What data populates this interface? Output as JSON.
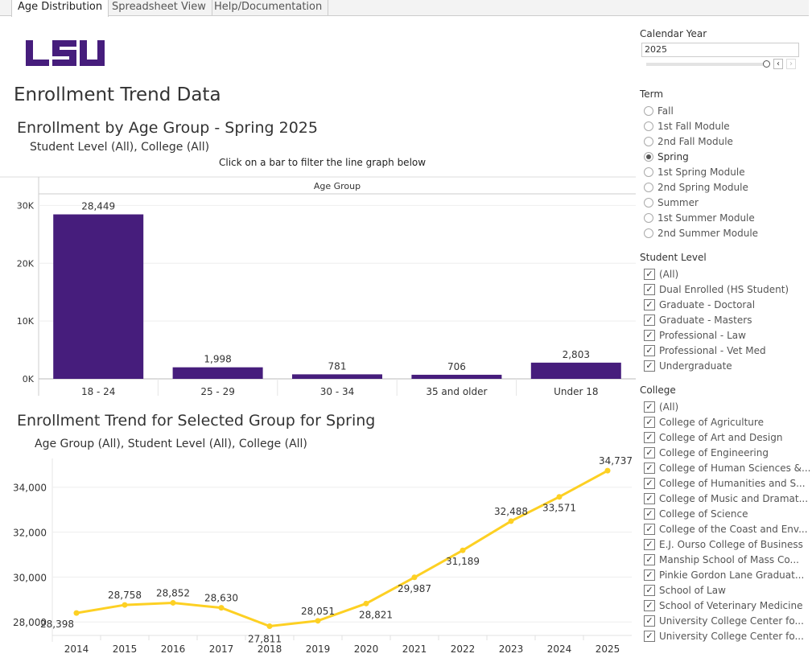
{
  "tabs": [
    "Age Distribution",
    "Spreadsheet View",
    "Help/Documentation"
  ],
  "logo_text": "LSU",
  "brand_color": "#461D7C",
  "line_color": "#FDD023",
  "page_title": "Enrollment Trend Data",
  "bar_section": {
    "title": "Enrollment by Age Group - Spring 2025",
    "subtitle": "Student Level (All), College (All)",
    "note": "Click on a bar to filter the line graph below"
  },
  "line_section": {
    "title": "Enrollment Trend for Selected Group for Spring",
    "subtitle": "Age Group (All), Student Level (All), College (All)"
  },
  "filters": {
    "calendar_year": {
      "label": "Calendar Year",
      "value": "2025"
    },
    "term": {
      "label": "Term",
      "options": [
        "Fall",
        "1st Fall Module",
        "2nd Fall Module",
        "Spring",
        "1st Spring Module",
        "2nd Spring Module",
        "Summer",
        "1st Summer Module",
        "2nd Summer Module"
      ],
      "selected": "Spring"
    },
    "student_level": {
      "label": "Student Level",
      "options": [
        "(All)",
        "Dual Enrolled (HS Student)",
        "Graduate - Doctoral",
        "Graduate - Masters",
        "Professional - Law",
        "Professional - Vet Med",
        "Undergraduate"
      ]
    },
    "college": {
      "label": "College",
      "options": [
        "(All)",
        "College of Agriculture",
        "College of Art and Design",
        "College of Engineering",
        "College of Human Sciences &...",
        "College of Humanities and S...",
        "College of Music and Dramat...",
        "College of Science",
        "College of the Coast and Env...",
        "E.J. Ourso College of Business",
        "Manship School of Mass Co...",
        "Pinkie Gordon Lane Graduat...",
        "School of Law",
        "School of Veterinary Medicine",
        "University College Center fo...",
        "University College Center fo..."
      ]
    }
  },
  "chart_data": [
    {
      "type": "bar",
      "header": "Age Group",
      "categories": [
        "18 - 24",
        "25 - 29",
        "30 - 34",
        "35 and older",
        "Under 18"
      ],
      "values": [
        28449,
        1998,
        781,
        706,
        2803
      ],
      "labels": [
        "28,449",
        "1,998",
        "781",
        "706",
        "2,803"
      ],
      "ytick_labels": [
        "0K",
        "10K",
        "20K",
        "30K"
      ],
      "yticks": [
        0,
        10000,
        20000,
        30000
      ],
      "ylim": [
        0,
        32000
      ],
      "grid": true
    },
    {
      "type": "line",
      "x": [
        "2014",
        "2015",
        "2016",
        "2017",
        "2018",
        "2019",
        "2020",
        "2021",
        "2022",
        "2023",
        "2024",
        "2025"
      ],
      "values": [
        28398,
        28758,
        28852,
        28630,
        27811,
        28051,
        28821,
        29987,
        31189,
        32488,
        33571,
        34737
      ],
      "labels": [
        "28,398",
        "28,758",
        "28,852",
        "28,630",
        "27,811",
        "28,051",
        "28,821",
        "29,987",
        "31,189",
        "32,488",
        "33,571",
        "34,737"
      ],
      "ytick_labels": [
        "28,000",
        "30,000",
        "32,000",
        "34,000"
      ],
      "yticks": [
        28000,
        30000,
        32000,
        34000
      ],
      "ylim": [
        27400,
        35100
      ],
      "grid": true
    }
  ]
}
